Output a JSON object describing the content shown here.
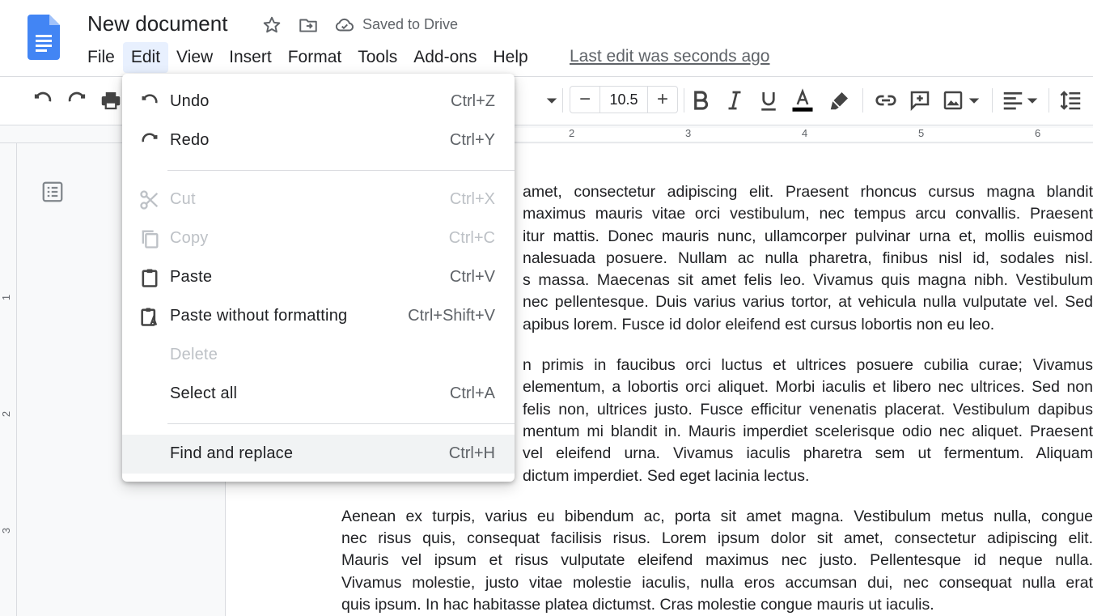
{
  "header": {
    "title": "New document",
    "saved_status": "Saved to Drive",
    "last_edit": "Last edit was seconds ago",
    "brand_color": "#4285f4"
  },
  "menubar": {
    "items": [
      "File",
      "Edit",
      "View",
      "Insert",
      "Format",
      "Tools",
      "Add-ons",
      "Help"
    ],
    "active": "Edit"
  },
  "toolbar": {
    "font_size": "10.5",
    "decrease_label": "−",
    "increase_label": "+"
  },
  "ruler": {
    "marks": [
      "2",
      "3",
      "4",
      "5",
      "6"
    ],
    "vmarks": [
      "1",
      "2",
      "3"
    ]
  },
  "edit_menu": {
    "items": [
      {
        "label": "Undo",
        "shortcut": "Ctrl+Z",
        "icon": "undo-icon",
        "enabled": true
      },
      {
        "label": "Redo",
        "shortcut": "Ctrl+Y",
        "icon": "redo-icon",
        "enabled": true
      },
      {
        "label": "Cut",
        "shortcut": "Ctrl+X",
        "icon": "scissors-icon",
        "enabled": false
      },
      {
        "label": "Copy",
        "shortcut": "Ctrl+C",
        "icon": "copy-icon",
        "enabled": false
      },
      {
        "label": "Paste",
        "shortcut": "Ctrl+V",
        "icon": "clipboard-icon",
        "enabled": true
      },
      {
        "label": "Paste without formatting",
        "shortcut": "Ctrl+Shift+V",
        "icon": "clipboard-text-icon",
        "enabled": true
      },
      {
        "label": "Delete",
        "shortcut": "",
        "icon": "",
        "enabled": false
      },
      {
        "label": "Select all",
        "shortcut": "Ctrl+A",
        "icon": "",
        "enabled": true
      },
      {
        "label": "Find and replace",
        "shortcut": "Ctrl+H",
        "icon": "",
        "enabled": true
      }
    ]
  },
  "document": {
    "paragraphs": [
      [
        "amet, consectetur adipiscing elit. Praesent rhoncus cursus magna blandit",
        "maximus mauris vitae orci vestibulum, nec tempus arcu convallis. Praesent",
        "itur mattis. Donec mauris nunc, ullamcorper pulvinar urna et, mollis euismod",
        "nalesuada posuere. Nullam ac nulla pharetra, finibus nisl id, sodales nisl.",
        "s massa. Maecenas sit amet felis leo. Vivamus quis magna nibh. Vestibulum",
        "nec pellentesque. Duis varius varius tortor, at vehicula nulla vulputate vel. Sed",
        "apibus lorem. Fusce id dolor eleifend est cursus lobortis non eu leo."
      ],
      [
        "n primis in faucibus orci luctus et ultrices posuere cubilia curae; Vivamus",
        "elementum, a lobortis orci aliquet. Morbi iaculis et libero nec ultrices. Sed non",
        "felis non, ultrices justo. Fusce efficitur venenatis placerat. Vestibulum dapibus",
        "mentum mi blandit in. Mauris imperdiet scelerisque odio nec aliquet. Praesent",
        "vel eleifend urna. Vivamus iaculis pharetra sem ut fermentum. Aliquam",
        "dictum imperdiet. Sed eget lacinia lectus."
      ],
      [
        "Aenean ex turpis, varius eu bibendum ac, porta sit amet magna. Vestibulum metus nulla, congue",
        "nec risus quis, consequat facilisis risus. Lorem ipsum dolor sit amet, consectetur adipiscing elit.",
        "Mauris vel ipsum et risus vulputate eleifend maximus nec justo. Pellentesque id neque nulla.",
        "Vivamus molestie, justo vitae molestie iaculis, nulla eros accumsan dui, nec consequat nulla erat",
        "quis ipsum. In hac habitasse platea dictumst. Cras molestie congue mauris ut iaculis."
      ]
    ]
  }
}
